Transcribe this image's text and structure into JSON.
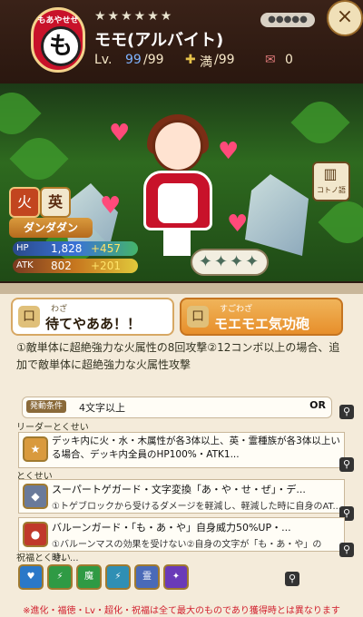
{
  "header": {
    "badge_top": "もあやせせ",
    "badge_char": "も",
    "stars": "★★★★★★",
    "name": "モモ(アルバイト)",
    "lv_label": "Lv.",
    "lv_current": "99",
    "lv_max": "/99",
    "awake_label": "満",
    "awake_max": "/99",
    "ticket_count": "0",
    "close": "×"
  },
  "art": {
    "book_label": "コトノ語",
    "element": "火",
    "rank": "英",
    "type": "ダンダダン",
    "hp_label": "HP",
    "hp": "1,828",
    "hp_plus": "+457",
    "atk_label": "ATK",
    "atk": "802",
    "atk_plus": "+201",
    "stars_box": "✦✦✦✦"
  },
  "tabs": {
    "waza_small": "わざ",
    "waza": "待てやああ！！",
    "sugo_small": "すごわざ",
    "sugo": "モエモエ気功砲"
  },
  "skill": {
    "desc": "①敵単体に超絶強力な火属性の8回攻撃②12コンボ以上の場合、追加で敵単体に超絶強力な火属性攻撃",
    "cond_tag": "発動条件",
    "cond_text": "4文字以上",
    "cond_or": "OR"
  },
  "leader": {
    "label": "リーダーとくせい",
    "title": "デッキ内に火・水・木属性が各3体以上、英・霊種族が各3体以上いる場合、デッキ内全員のHP100%・ATK1..."
  },
  "traits": {
    "label": "とくせい",
    "items": [
      {
        "title": "スーパートゲガード・文字変換「あ・や・せ・ぜ」・デ...",
        "desc": "①トゲブロックから受けるダメージを軽減し、軽減した時に自身のAT..."
      },
      {
        "title": "バルーンガード・「も・あ・や」自身威力50%UP・...",
        "desc": "①バルーンマスの効果を受けない②自身の文字が「も・あ・や」の時、..."
      }
    ]
  },
  "blessing": {
    "label": "祝福とくせい",
    "icons": [
      "♥",
      "⚡",
      "魔",
      "⚡",
      "霊",
      "✦"
    ]
  },
  "footnote": "※進化・福徳・Lv・超化・祝福は全て最大のものであり獲得時とは異なります"
}
